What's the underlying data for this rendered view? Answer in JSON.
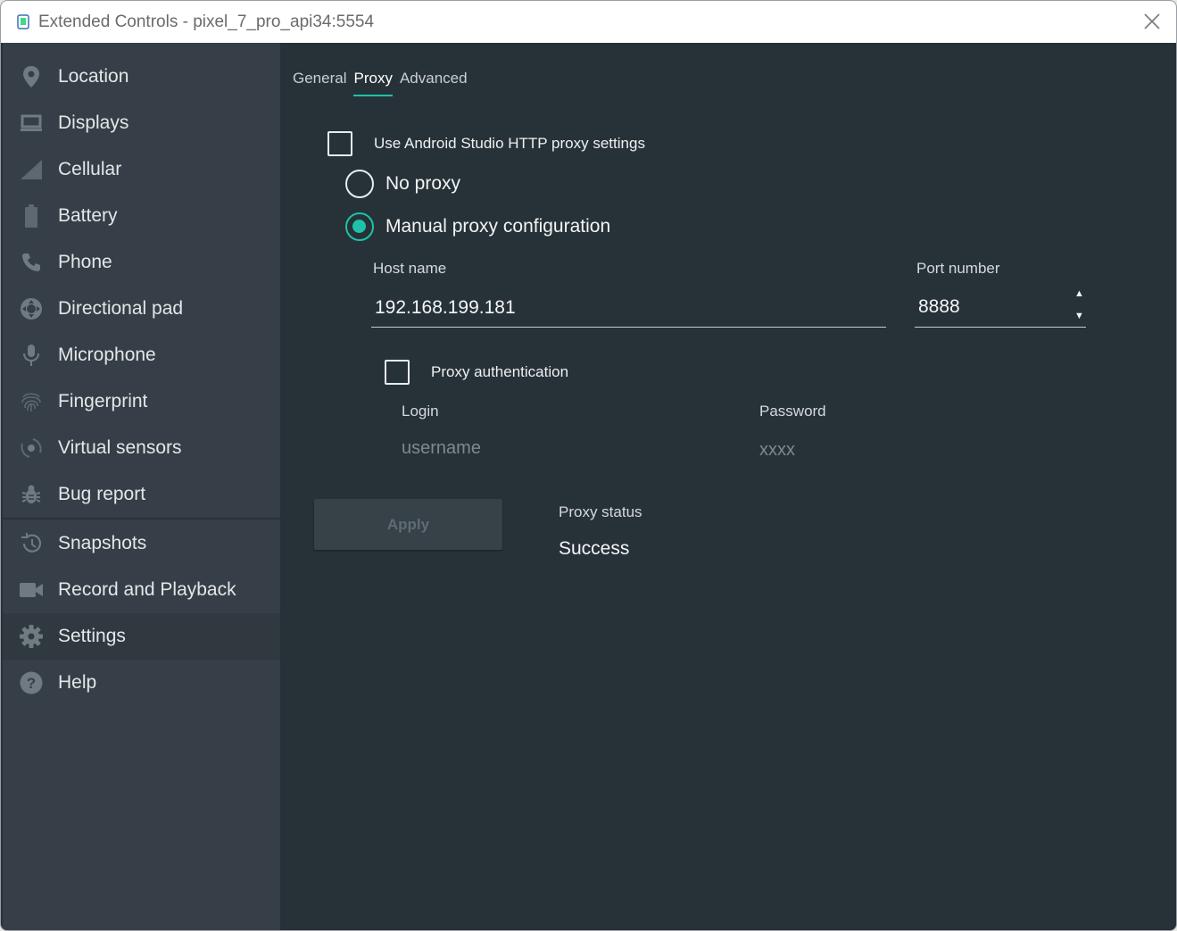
{
  "window": {
    "title": "Extended Controls - pixel_7_pro_api34:5554"
  },
  "sidebar": {
    "items": [
      {
        "label": "Location",
        "icon": "location-pin-icon"
      },
      {
        "label": "Displays",
        "icon": "display-icon"
      },
      {
        "label": "Cellular",
        "icon": "cellular-signal-icon"
      },
      {
        "label": "Battery",
        "icon": "battery-icon"
      },
      {
        "label": "Phone",
        "icon": "phone-icon"
      },
      {
        "label": "Directional pad",
        "icon": "dpad-icon"
      },
      {
        "label": "Microphone",
        "icon": "microphone-icon"
      },
      {
        "label": "Fingerprint",
        "icon": "fingerprint-icon"
      },
      {
        "label": "Virtual sensors",
        "icon": "virtual-sensors-icon"
      },
      {
        "label": "Bug report",
        "icon": "bug-icon"
      },
      {
        "label": "Snapshots",
        "icon": "history-icon"
      },
      {
        "label": "Record and Playback",
        "icon": "video-camera-icon"
      },
      {
        "label": "Settings",
        "icon": "gear-icon"
      },
      {
        "label": "Help",
        "icon": "help-icon"
      }
    ],
    "active": "Settings"
  },
  "tabs": [
    {
      "label": "General"
    },
    {
      "label": "Proxy"
    },
    {
      "label": "Advanced"
    }
  ],
  "active_tab": "Proxy",
  "proxy": {
    "use_studio_settings_label": "Use Android Studio HTTP proxy settings",
    "use_studio_settings_checked": false,
    "no_proxy_label": "No proxy",
    "manual_label": "Manual proxy configuration",
    "selected_mode": "manual",
    "host_label": "Host name",
    "host_value": "192.168.199.181",
    "port_label": "Port number",
    "port_value": "8888",
    "auth_label": "Proxy authentication",
    "auth_checked": false,
    "login_label": "Login",
    "login_placeholder": "username",
    "password_label": "Password",
    "password_placeholder": "xxxx",
    "apply_label": "Apply",
    "status_label": "Proxy status",
    "status_value": "Success"
  },
  "colors": {
    "accent": "#1ec2a8",
    "main_bg": "#273238",
    "sidebar_bg": "#363f47"
  }
}
